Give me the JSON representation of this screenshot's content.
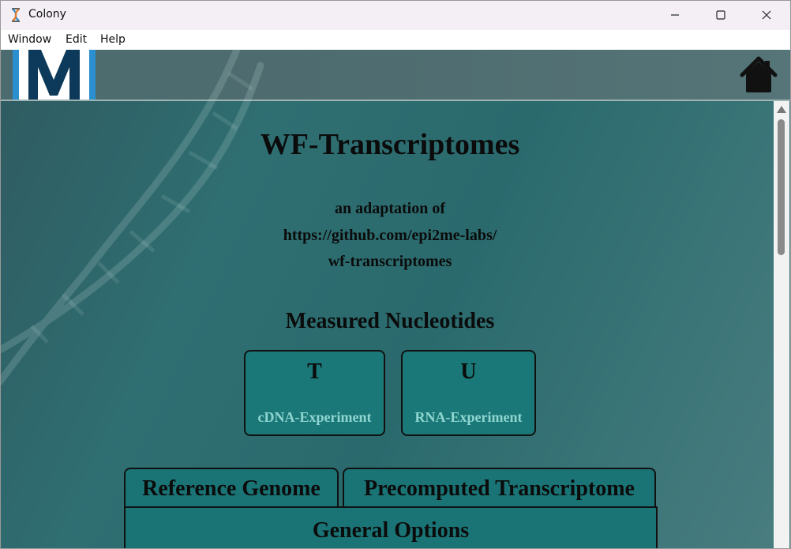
{
  "window": {
    "title": "Colony",
    "controls": {
      "minimize": "–",
      "maximize": "☐",
      "close": "✕"
    }
  },
  "menu": {
    "items": [
      "Window",
      "Edit",
      "Help"
    ]
  },
  "header": {
    "logo_letter": "M"
  },
  "page": {
    "title": "WF-Transcriptomes",
    "subtitle_lines": [
      "an adaptation of",
      "https://github.com/epi2me-labs/",
      "wf-transcriptomes"
    ],
    "section_title": "Measured Nucleotides",
    "cards": [
      {
        "letter": "T",
        "label": "cDNA-Experiment"
      },
      {
        "letter": "U",
        "label": "RNA-Experiment"
      }
    ],
    "tabs": [
      "Reference Genome",
      "Precomputed Transcriptome"
    ],
    "panel_title": "General Options"
  },
  "colors": {
    "accent": "#1a7476",
    "card_label": "#8fd6d1",
    "logo_blue": "#2b8fd0",
    "logo_dark": "#0d3a5a"
  },
  "icons": {
    "app": "dna-icon",
    "home": "home-icon"
  }
}
